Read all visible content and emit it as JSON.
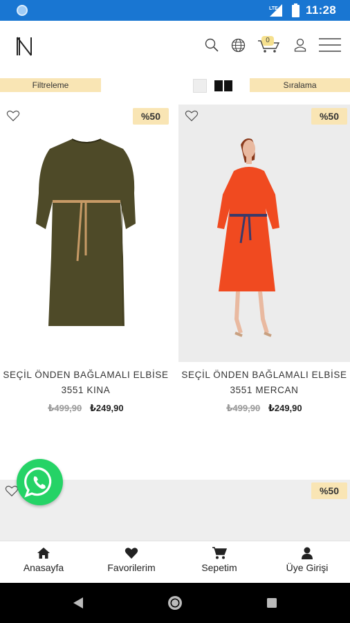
{
  "status": {
    "time": "11:28",
    "network": "LTE"
  },
  "header": {
    "logo": "N",
    "icons": [
      "search-icon",
      "globe-icon",
      "cart-icon",
      "user-icon",
      "menu-icon"
    ],
    "cart_count": "0"
  },
  "toolbar": {
    "filter_label": "Filtreleme",
    "sort_label": "Sıralama",
    "view_options": [
      "single-column",
      "two-column"
    ]
  },
  "products": [
    {
      "title": "SEÇİL ÖNDEN BAĞLAMALI ELBİSE 3551 KINA",
      "old_price": "₺499,90",
      "new_price": "₺249,90",
      "discount": "%50",
      "dress_color": "#4e4a28"
    },
    {
      "title": "SEÇİL ÖNDEN BAĞLAMALI ELBİSE 3551 MERCAN",
      "old_price": "₺499,90",
      "new_price": "₺249,90",
      "discount": "%50",
      "dress_color": "#f04a20"
    },
    {
      "discount": "%50"
    }
  ],
  "bottom_nav": [
    {
      "label": "Anasayfa",
      "icon": "home-icon"
    },
    {
      "label": "Favorilerim",
      "icon": "heart-icon"
    },
    {
      "label": "Sepetim",
      "icon": "cart-icon"
    },
    {
      "label": "Üye Girişi",
      "icon": "user-icon"
    }
  ],
  "colors": {
    "statusbar": "#1976d2",
    "accent_pill": "#f9e5b4",
    "whatsapp": "#25d366"
  }
}
